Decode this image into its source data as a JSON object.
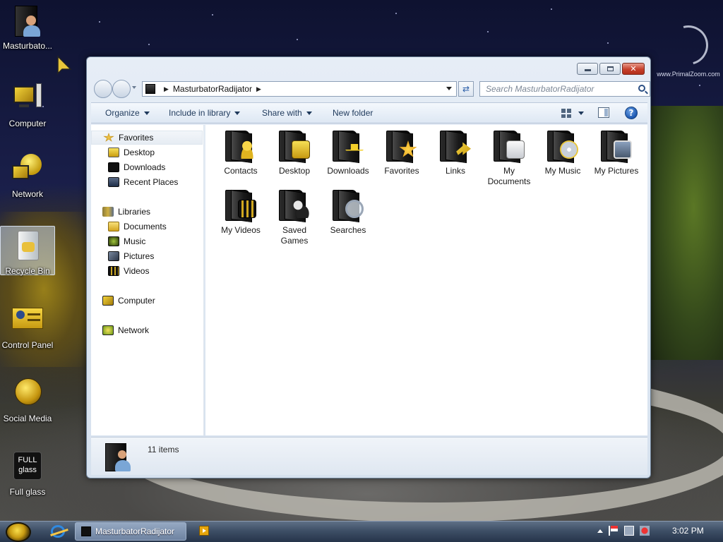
{
  "desktop": {
    "icons": [
      {
        "label": "Masturbato..."
      },
      {
        "label": "Computer"
      },
      {
        "label": "Network"
      },
      {
        "label": "Recycle Bin"
      },
      {
        "label": "Control Panel"
      },
      {
        "label": "Social Media"
      },
      {
        "label": "Full glass"
      }
    ],
    "full_glass_logo_line1": "FULL",
    "full_glass_logo_line2": "glass",
    "watermark": "www.PrimalZoom.com"
  },
  "window": {
    "address": {
      "segments": [
        "MasturbatorRadijator"
      ]
    },
    "search_placeholder": "Search MasturbatorRadijator",
    "toolbar": {
      "organize": "Organize",
      "include_in_library": "Include in library",
      "share_with": "Share with",
      "new_folder": "New folder"
    },
    "nav": {
      "favorites": "Favorites",
      "desktop": "Desktop",
      "downloads": "Downloads",
      "recent_places": "Recent Places",
      "libraries": "Libraries",
      "documents": "Documents",
      "music": "Music",
      "pictures": "Pictures",
      "videos": "Videos",
      "computer": "Computer",
      "network": "Network"
    },
    "items": [
      {
        "label": "Contacts"
      },
      {
        "label": "Desktop"
      },
      {
        "label": "Downloads"
      },
      {
        "label": "Favorites"
      },
      {
        "label": "Links"
      },
      {
        "label": "My Documents"
      },
      {
        "label": "My Music"
      },
      {
        "label": "My Pictures"
      },
      {
        "label": "My Videos"
      },
      {
        "label": "Saved Games"
      },
      {
        "label": "Searches"
      }
    ],
    "details": {
      "count": "11 items"
    }
  },
  "taskbar": {
    "active_window": "MasturbatorRadijator",
    "clock": "3:02 PM"
  },
  "colors": {
    "accent": "#1e395b",
    "close_button": "#c6402b",
    "taskbar": "#3e4f66"
  }
}
